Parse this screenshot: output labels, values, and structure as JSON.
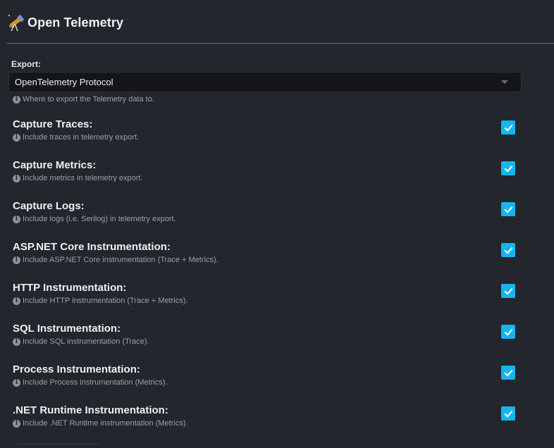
{
  "header": {
    "title": "Open Telemetry",
    "logo_icon": "telescope-icon"
  },
  "export": {
    "label": "Export:",
    "selected": "OpenTelemetry Protocol",
    "hint": "Where to export the Telemetry data to."
  },
  "options": [
    {
      "title": "Capture Traces:",
      "hint": "Include traces in telemetry export.",
      "checked": true
    },
    {
      "title": "Capture Metrics:",
      "hint": "Include metrics in telemetry export.",
      "checked": true
    },
    {
      "title": "Capture Logs:",
      "hint": "Include logs (i.e. Serilog) in telemetry export.",
      "checked": true
    },
    {
      "title": "ASP.NET Core Instrumentation:",
      "hint": "Include ASP.NET Core instrumentation (Trace + Metrics).",
      "checked": true
    },
    {
      "title": "HTTP Instrumentation:",
      "hint": "Include HTTP instrumentation (Trace + Metrics).",
      "checked": true
    },
    {
      "title": "SQL Instrumentation:",
      "hint": "Include SQL instrumentation (Trace).",
      "checked": true
    },
    {
      "title": "Process Instrumentation:",
      "hint": "Include Process instrumentation (Metrics).",
      "checked": true
    },
    {
      "title": ".NET Runtime Instrumentation:",
      "hint": "Include .NET Runtime instrumentation (Metrics).",
      "checked": true
    }
  ],
  "colors": {
    "background": "#23262c",
    "checkbox": "#16b5ee",
    "select_bg": "#141619"
  }
}
